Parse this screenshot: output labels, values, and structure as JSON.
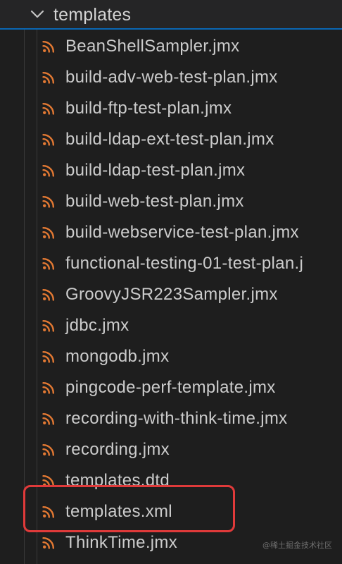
{
  "colors": {
    "background": "#1e1e1e",
    "text": "#cccccc",
    "rss_icon": "#e37933",
    "selection_border": "#0a67b3",
    "highlight": "#e03a3a"
  },
  "explorer": {
    "folder": {
      "name": "templates",
      "expanded": true,
      "chevron_icon": "chevron-down-icon"
    },
    "files": [
      {
        "name": "BeanShellSampler.jmx",
        "icon": "rss-icon"
      },
      {
        "name": "build-adv-web-test-plan.jmx",
        "icon": "rss-icon"
      },
      {
        "name": "build-ftp-test-plan.jmx",
        "icon": "rss-icon"
      },
      {
        "name": "build-ldap-ext-test-plan.jmx",
        "icon": "rss-icon"
      },
      {
        "name": "build-ldap-test-plan.jmx",
        "icon": "rss-icon"
      },
      {
        "name": "build-web-test-plan.jmx",
        "icon": "rss-icon"
      },
      {
        "name": "build-webservice-test-plan.jmx",
        "icon": "rss-icon"
      },
      {
        "name": "functional-testing-01-test-plan.j",
        "icon": "rss-icon"
      },
      {
        "name": "GroovyJSR223Sampler.jmx",
        "icon": "rss-icon"
      },
      {
        "name": "jdbc.jmx",
        "icon": "rss-icon"
      },
      {
        "name": "mongodb.jmx",
        "icon": "rss-icon"
      },
      {
        "name": "pingcode-perf-template.jmx",
        "icon": "rss-icon"
      },
      {
        "name": "recording-with-think-time.jmx",
        "icon": "rss-icon"
      },
      {
        "name": "recording.jmx",
        "icon": "rss-icon"
      },
      {
        "name": "templates.dtd",
        "icon": "rss-icon"
      },
      {
        "name": "templates.xml",
        "icon": "rss-icon",
        "highlighted": true
      },
      {
        "name": "ThinkTime.jmx",
        "icon": "rss-icon"
      }
    ]
  },
  "watermark": "@稀土掘金技术社区"
}
